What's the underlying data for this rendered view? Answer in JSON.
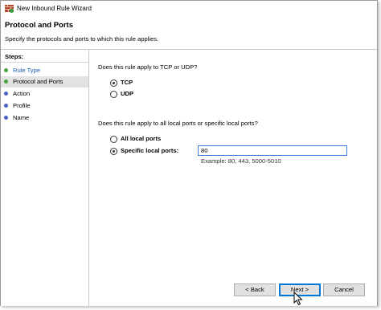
{
  "window": {
    "title": "New Inbound Rule Wizard"
  },
  "header": {
    "title": "Protocol and Ports",
    "description": "Specify the protocols and ports to which this rule applies."
  },
  "sidebar": {
    "heading": "Steps:",
    "items": [
      {
        "label": "Rule Type",
        "dot_color": "#44a343",
        "state": "done"
      },
      {
        "label": "Protocol and Ports",
        "dot_color": "#44a343",
        "state": "current"
      },
      {
        "label": "Action",
        "dot_color": "#4a5fc1",
        "state": "pending"
      },
      {
        "label": "Profile",
        "dot_color": "#4a5fc1",
        "state": "pending"
      },
      {
        "label": "Name",
        "dot_color": "#4a5fc1",
        "state": "pending"
      }
    ]
  },
  "protocol": {
    "question": "Does this rule apply to TCP or UDP?",
    "options": [
      {
        "label": "TCP",
        "checked": true
      },
      {
        "label": "UDP",
        "checked": false
      }
    ]
  },
  "ports": {
    "question": "Does this rule apply to all local ports or specific local ports?",
    "options": [
      {
        "label": "All local ports",
        "checked": false
      },
      {
        "label": "Specific local ports:",
        "checked": true
      }
    ],
    "value": "80",
    "example": "Example: 80, 443, 5000-5010"
  },
  "buttons": {
    "back": "< Back",
    "next": "Next >",
    "cancel": "Cancel"
  },
  "colors": {
    "done_dot": "#44a343",
    "pending_dot": "#4a5fc1",
    "link": "#1a5fb4",
    "focus": "#0078d7"
  }
}
